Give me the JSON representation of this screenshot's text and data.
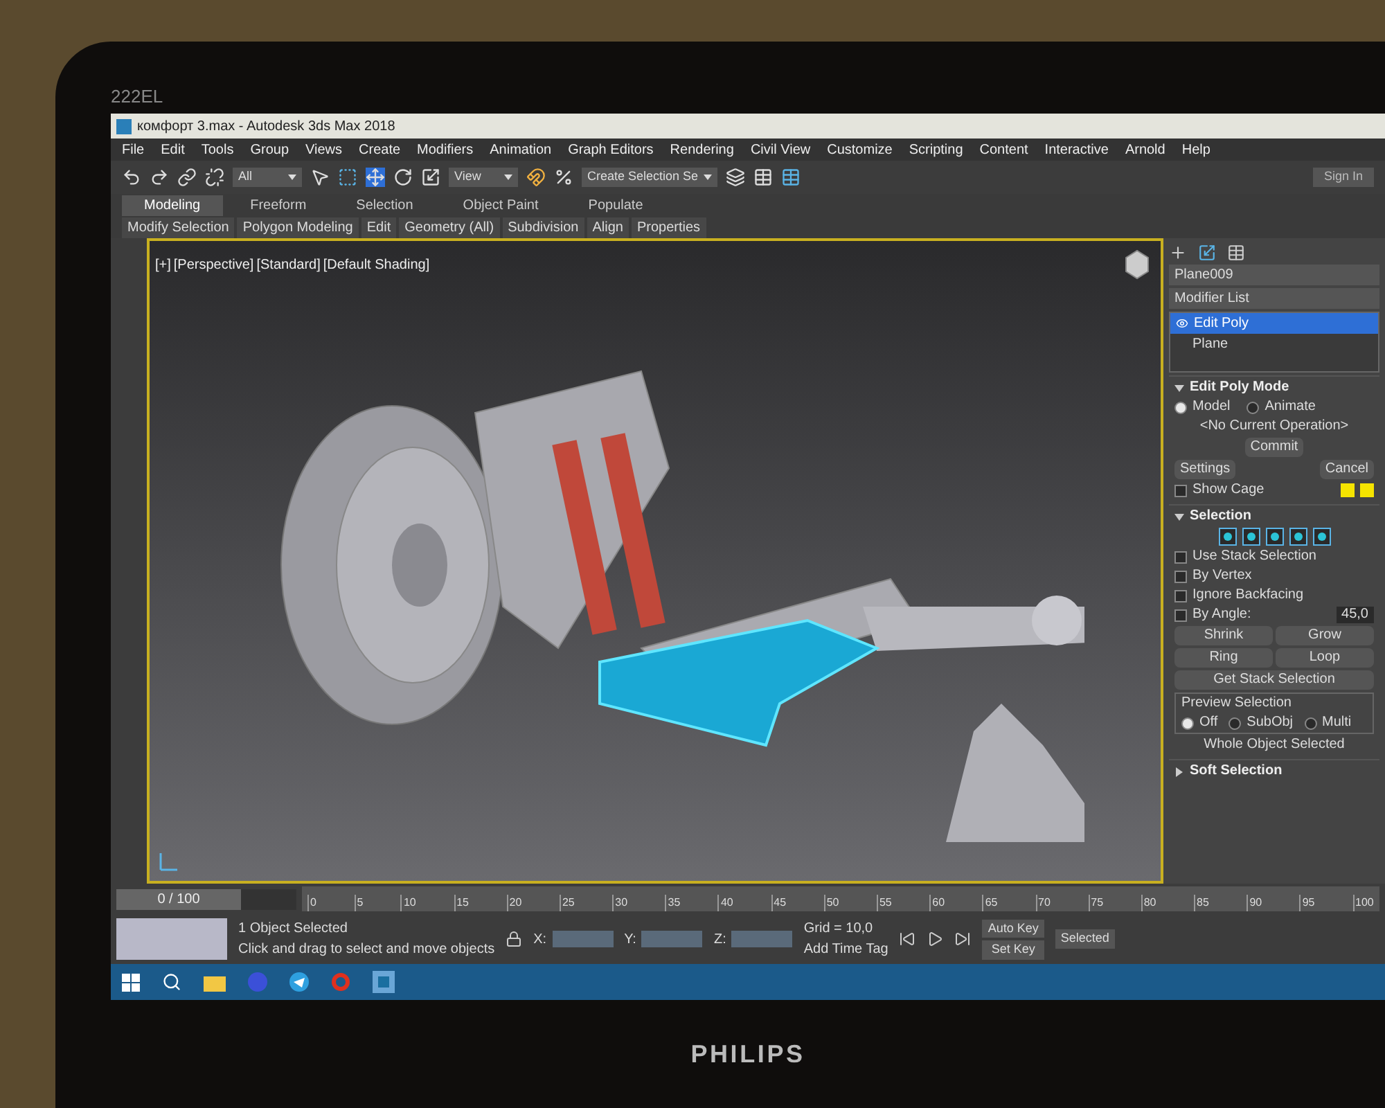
{
  "monitor": {
    "model": "222EL",
    "brand": "PHILIPS"
  },
  "window": {
    "title": "комфорт 3.max - Autodesk 3ds Max 2018"
  },
  "menu": [
    "File",
    "Edit",
    "Tools",
    "Group",
    "Views",
    "Create",
    "Modifiers",
    "Animation",
    "Graph Editors",
    "Rendering",
    "Civil View",
    "Customize",
    "Scripting",
    "Content",
    "Interactive",
    "Arnold",
    "Help"
  ],
  "toolbar": {
    "selection_filter": "All",
    "reference_coord": "View",
    "named_selection": "Create Selection Se",
    "sign_in": "Sign In"
  },
  "ribbon": {
    "tabs": [
      {
        "label": "Modeling",
        "selected": true
      },
      {
        "label": "Freeform",
        "selected": false
      },
      {
        "label": "Selection",
        "selected": false
      },
      {
        "label": "Object Paint",
        "selected": false
      },
      {
        "label": "Populate",
        "selected": false
      }
    ],
    "panels": [
      "Modify Selection",
      "Polygon Modeling",
      "Edit",
      "Geometry (All)",
      "Subdivision",
      "Align",
      "Properties"
    ]
  },
  "viewport": {
    "labels": [
      "[+]",
      "[Perspective]",
      "[Standard]",
      "[Default Shading]"
    ]
  },
  "command_panel": {
    "object_name": "Plane009",
    "modifier_list": "Modifier List",
    "stack": [
      {
        "label": "Edit Poly",
        "selected": true
      },
      {
        "label": "Plane",
        "selected": false
      }
    ],
    "rollouts": [
      {
        "kind": "mode",
        "title": "Edit Poly Mode",
        "expanded": true,
        "modes": [
          {
            "label": "Model",
            "selected": true
          },
          {
            "label": "Animate",
            "selected": false
          }
        ],
        "operation": "<No Current Operation>",
        "commit": "Commit",
        "settings": "Settings",
        "cancel": "Cancel",
        "show_cage": {
          "label": "Show Cage",
          "checked": false
        }
      },
      {
        "kind": "selection",
        "title": "Selection",
        "expanded": true,
        "options": [
          {
            "label": "Use Stack Selection",
            "checked": false
          },
          {
            "label": "By Vertex",
            "checked": false
          },
          {
            "label": "Ignore Backfacing",
            "checked": false
          },
          {
            "label": "By Angle:",
            "checked": false
          }
        ],
        "angle": "45,0",
        "buttons": [
          "Shrink",
          "Grow",
          "Ring",
          "Loop"
        ],
        "get_stack": "Get Stack Selection",
        "preview_title": "Preview Selection",
        "preview": [
          {
            "label": "Off",
            "selected": true
          },
          {
            "label": "SubObj",
            "selected": false
          },
          {
            "label": "Multi",
            "selected": false
          }
        ],
        "status": "Whole Object Selected"
      },
      {
        "kind": "plain",
        "title": "Soft Selection",
        "expanded": false
      }
    ]
  },
  "timeline": {
    "frame": "0 / 100",
    "level": 0,
    "ticks": [
      "0",
      "5",
      "10",
      "15",
      "20",
      "25",
      "30",
      "35",
      "40",
      "45",
      "50",
      "55",
      "60",
      "65",
      "70",
      "75",
      "80",
      "85",
      "90",
      "95",
      "100"
    ]
  },
  "status": {
    "selected": "1 Object Selected",
    "prompt": "Click and drag to select and move objects",
    "x": "X:",
    "y": "Y:",
    "z": "Z:",
    "grid": "Grid = 10,0",
    "time_tag": "Add Time Tag",
    "auto_key": "Auto Key",
    "set_key": "Set Key",
    "key_filter": "Selected"
  }
}
